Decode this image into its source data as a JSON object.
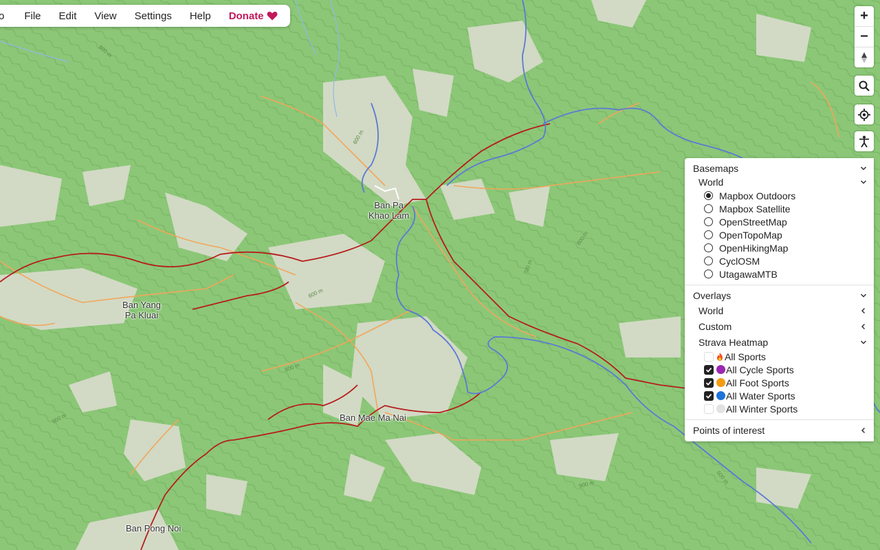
{
  "menu": {
    "logo_fragment": "o",
    "items": [
      "File",
      "Edit",
      "View",
      "Settings",
      "Help"
    ],
    "donate": "Donate"
  },
  "controls": {
    "zoom_in": "+",
    "zoom_out": "−"
  },
  "layers": {
    "basemaps": {
      "title": "Basemaps",
      "group": "World",
      "options": [
        {
          "label": "Mapbox Outdoors",
          "selected": true
        },
        {
          "label": "Mapbox Satellite",
          "selected": false
        },
        {
          "label": "OpenStreetMap",
          "selected": false
        },
        {
          "label": "OpenTopoMap",
          "selected": false
        },
        {
          "label": "OpenHikingMap",
          "selected": false
        },
        {
          "label": "CyclOSM",
          "selected": false
        },
        {
          "label": "UtagawaMTB",
          "selected": false
        }
      ]
    },
    "overlays": {
      "title": "Overlays",
      "groups": [
        "World",
        "Custom"
      ],
      "strava": {
        "title": "Strava Heatmap",
        "options": [
          {
            "label": "All Sports",
            "checked": false,
            "emoji": "fire"
          },
          {
            "label": "All Cycle Sports",
            "checked": true,
            "emoji": "purple-circle"
          },
          {
            "label": "All Foot Sports",
            "checked": true,
            "emoji": "orange-circle"
          },
          {
            "label": "All Water Sports",
            "checked": true,
            "emoji": "blue-circle"
          },
          {
            "label": "All Winter Sports",
            "checked": false,
            "emoji": "white-circle"
          }
        ]
      }
    },
    "poi": {
      "title": "Points of interest"
    }
  },
  "map_labels": {
    "town_center_1": "Ban Pa",
    "town_center_2": "Khao Lam",
    "town_west_1": "Ban Yang",
    "town_west_2": "Pa Kluai",
    "town_south": "Ban Mae Ma Nai",
    "town_sw": "Ban Pong Noi"
  },
  "contours": [
    "800 m",
    "600 m",
    "600 m",
    "800 m",
    "700 m",
    "800 m",
    "900 m",
    "900 m",
    "600 m"
  ],
  "colors": {
    "forest": "#8cc878",
    "clearing": "#d7dccb",
    "road_major": "#b71c1c",
    "road_minor": "#f2a65a",
    "river": "#5b79d6",
    "donate": "#c2185b"
  }
}
